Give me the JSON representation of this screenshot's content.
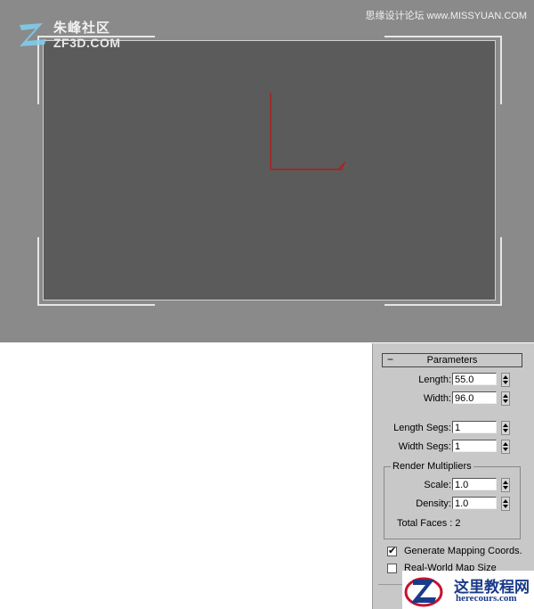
{
  "watermarks": {
    "site_cn": "朱峰社区",
    "site_en": "ZF3D.COM",
    "top_right": "思缘设计论坛 www.MISSYUAN.COM",
    "bottom_cn": "这里教程网",
    "bottom_en": "herecours.com"
  },
  "colors": {
    "gizmo": "#b02020",
    "viewport_bg": "#8a8a8a",
    "frame_bg": "#5b5b5b",
    "panel_bg": "#c8c8c8"
  },
  "parameters": {
    "header_label": "Parameters",
    "collapse_symbol": "−",
    "length_label": "Length:",
    "length_value": "55.0",
    "width_label": "Width:",
    "width_value": "96.0",
    "length_segs_label": "Length Segs:",
    "length_segs_value": "1",
    "width_segs_label": "Width Segs:",
    "width_segs_value": "1",
    "render_multipliers_title": "Render Multipliers",
    "scale_label": "Scale:",
    "scale_value": "1.0",
    "density_label": "Density:",
    "density_value": "1.0",
    "total_faces": "Total Faces : 2",
    "generate_mapping_label": "Generate Mapping Coords.",
    "generate_mapping_checked": true,
    "real_world_label": "Real-World Map Size",
    "real_world_checked": false,
    "check_glyph": "✔"
  }
}
